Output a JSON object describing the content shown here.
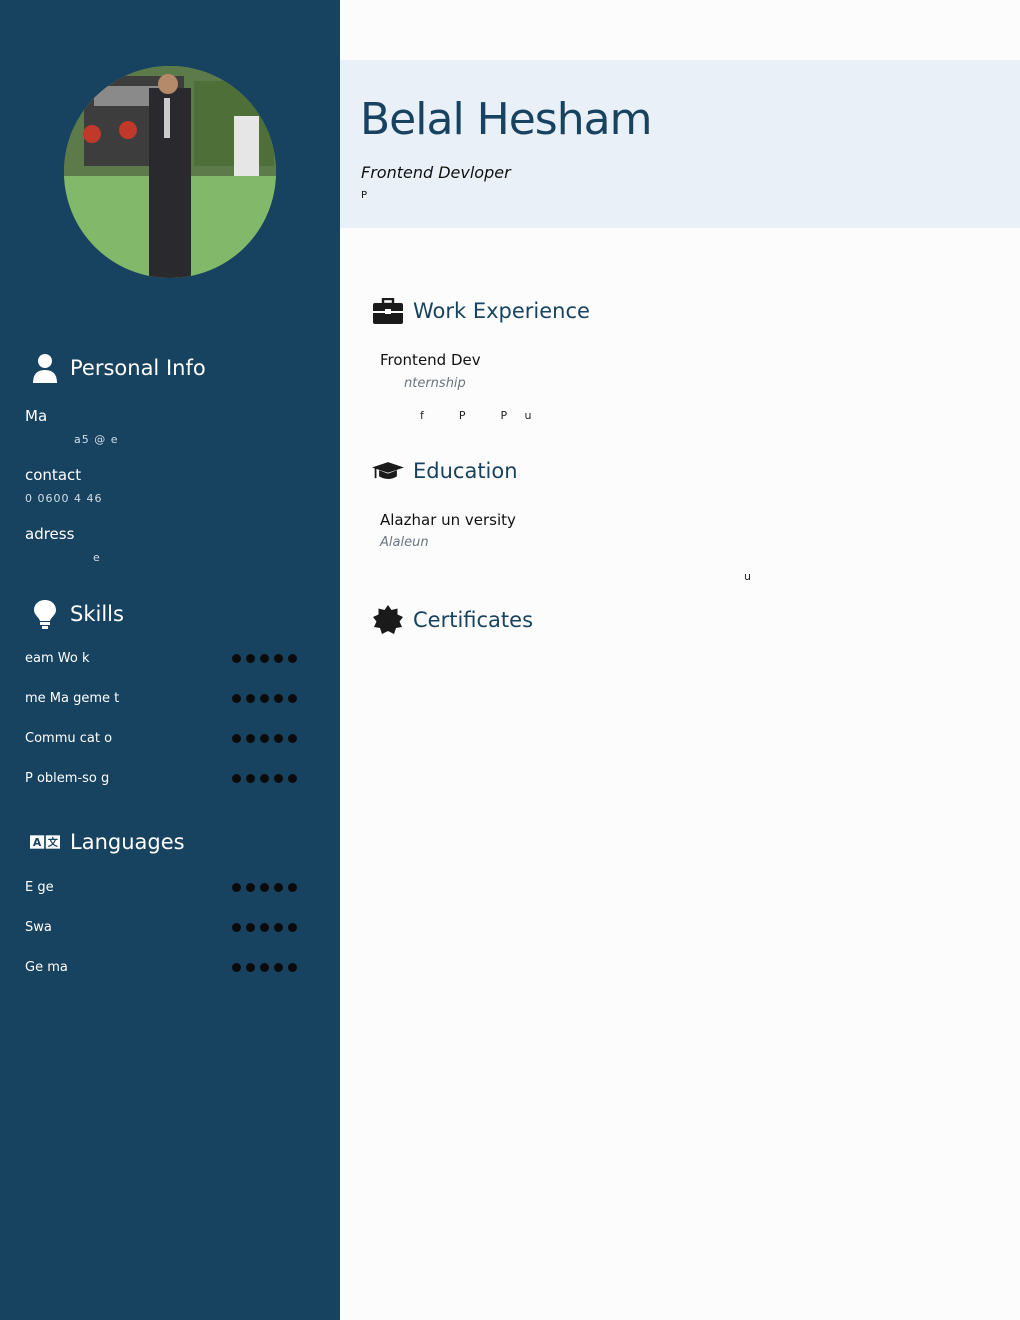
{
  "profile": {
    "name": "Belal Hesham",
    "role": "Frontend Devloper",
    "role_note": "P"
  },
  "personal_info": {
    "heading": "Personal Info",
    "mail_label": "Ma",
    "mail_value": "a5  @     e",
    "contact_label": "contact",
    "contact_value": "0  0600  4  46",
    "address_label": "adress",
    "address_value": "e"
  },
  "skills": {
    "heading": "Skills",
    "items": [
      {
        "name": "eam Wo k",
        "level": 5
      },
      {
        "name": "me Ma  geme  t",
        "level": 5
      },
      {
        "name": "Commu  cat o",
        "level": 5
      },
      {
        "name": "P oblem-so      g",
        "level": 5
      }
    ]
  },
  "languages": {
    "heading": "Languages",
    "items": [
      {
        "name": "E  ge",
        "level": 5
      },
      {
        "name": "Swa",
        "level": 5
      },
      {
        "name": "Ge  ma",
        "level": 5
      }
    ]
  },
  "work": {
    "heading": "Work Experience",
    "title": "Frontend Dev",
    "subtitle": "nternship",
    "detail": "f          P          P     u"
  },
  "education": {
    "heading": "Education",
    "title": "Alazhar  un versity",
    "subtitle": "Alaleun",
    "detail": "u"
  },
  "certificates": {
    "heading": "Certificates"
  },
  "colors": {
    "sidebar": "#184360",
    "header_bg": "#e9f0f7",
    "accent": "#184360"
  },
  "icons": {
    "personal": "user-icon",
    "skills": "lightbulb-icon",
    "languages": "language-icon",
    "work": "briefcase-icon",
    "education": "graduation-cap-icon",
    "certificates": "certificate-badge-icon"
  }
}
